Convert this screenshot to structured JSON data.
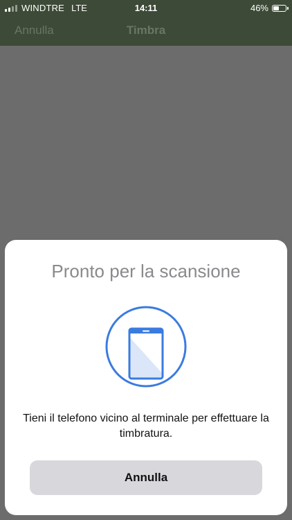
{
  "status_bar": {
    "carrier": "WINDTRE",
    "network": "LTE",
    "time": "14:11",
    "battery_percent": "46%"
  },
  "nav": {
    "left_label": "Annulla",
    "title": "Timbra"
  },
  "scan_sheet": {
    "title": "Pronto per la scansione",
    "message": "Tieni il telefono vicino al terminale per effettuare la timbratura.",
    "cancel_label": "Annulla",
    "icon": "phone-nfc-icon",
    "accent_color": "#3a7be0"
  },
  "colors": {
    "nav_bar": "#3d4a37",
    "overlay": "#6c6c6c",
    "button_bg": "#d8d8dc"
  }
}
